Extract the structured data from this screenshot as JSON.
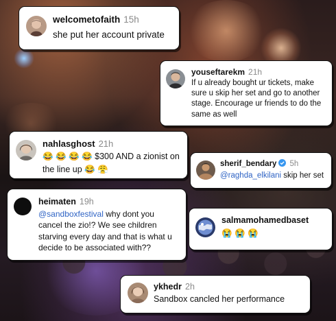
{
  "comments": [
    {
      "username": "welcometofaith",
      "time": "15h",
      "text": "she put her account private",
      "avatar_icon": "user-photo-woman"
    },
    {
      "username": "youseftarekm",
      "time": "21h",
      "text": "If u already bought ur tickets, make sure u skip her set and go to another stage. Encourage ur friends to do the same as well",
      "avatar_icon": "user-photo-man"
    },
    {
      "username": "nahlasghost",
      "time": "21h",
      "text_line1": "😂 😂 😂 😂 $300 AND a zionist on",
      "text_line2": "the line up 😂 😤",
      "avatar_icon": "user-photo-woman"
    },
    {
      "username": "sherif_bendary",
      "time": "5h",
      "verified": true,
      "mention": "@raghda_elkilani",
      "text": " skip her set",
      "avatar_icon": "user-photo-man"
    },
    {
      "username": "heimaten",
      "time": "19h",
      "mention": "@sandboxfestival",
      "text": " why dont you cancel the zio!? We see children starving every day and that is what u decide to be associated with??",
      "avatar_icon": "user-photo-dark"
    },
    {
      "username": "salmamohamedbaset",
      "reactions": "😭 😭 😭",
      "avatar_icon": "user-photo-globe"
    },
    {
      "username": "ykhedr",
      "time": "2h",
      "text": "Sandbox cancled her performance",
      "avatar_icon": "user-photo-woman"
    }
  ],
  "colors": {
    "mention": "#2e63c4",
    "timestamp": "#8a8a8a",
    "verified": "#3897f0"
  }
}
